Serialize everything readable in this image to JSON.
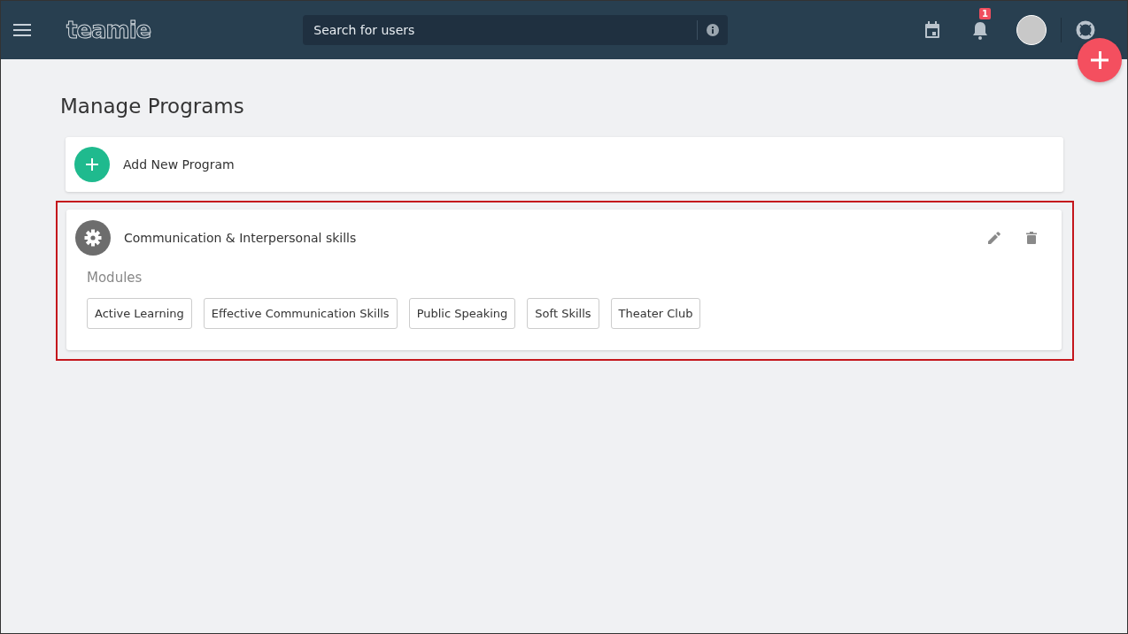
{
  "header": {
    "logo": "teamie",
    "search": {
      "placeholder": "Search for users"
    },
    "notifications": {
      "count": "1"
    }
  },
  "page": {
    "title": "Manage Programs",
    "add_label": "Add New Program"
  },
  "programs": [
    {
      "name": "Communication & Interpersonal skills",
      "highlighted": true,
      "modules_label": "Modules",
      "modules": [
        "Active Learning",
        "Effective Communication Skills",
        "Public Speaking",
        "Soft Skills",
        "Theater Club"
      ]
    }
  ]
}
